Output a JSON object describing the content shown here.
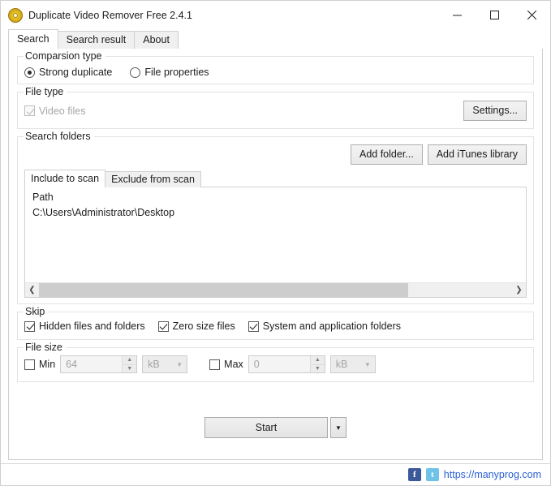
{
  "window": {
    "title": "Duplicate Video Remover Free 2.4.1",
    "icon": "app-disc-icon",
    "controls": {
      "minimize": "minimize-icon",
      "maximize": "maximize-icon",
      "close": "close-icon"
    }
  },
  "tabs": [
    {
      "label": "Search",
      "active": true
    },
    {
      "label": "Search result",
      "active": false
    },
    {
      "label": "About",
      "active": false
    }
  ],
  "comparison": {
    "group_label": "Comparsion type",
    "options": [
      {
        "label": "Strong duplicate",
        "checked": true
      },
      {
        "label": "File properties",
        "checked": false
      }
    ]
  },
  "file_type": {
    "group_label": "File type",
    "checkbox": {
      "label": "Video files",
      "checked": true,
      "disabled": true
    },
    "settings_button": "Settings..."
  },
  "search_folders": {
    "group_label": "Search folders",
    "add_folder_button": "Add folder...",
    "add_itunes_button": "Add iTunes library",
    "tabs": [
      {
        "label": "Include to scan",
        "active": true
      },
      {
        "label": "Exclude from scan",
        "active": false
      }
    ],
    "column_header": "Path",
    "rows": [
      "C:\\Users\\Administrator\\Desktop"
    ],
    "scroll": {
      "left_arrow": "chevron-left-icon",
      "right_arrow": "chevron-right-icon",
      "thumb_percent": 78
    }
  },
  "skip": {
    "group_label": "Skip",
    "options": [
      {
        "label": "Hidden files and folders",
        "checked": true
      },
      {
        "label": "Zero size files",
        "checked": true
      },
      {
        "label": "System and application folders",
        "checked": true
      }
    ]
  },
  "file_size": {
    "group_label": "File size",
    "min": {
      "label": "Min",
      "checked": false,
      "value": "64",
      "unit": "kB"
    },
    "max": {
      "label": "Max",
      "checked": false,
      "value": "0",
      "unit": "kB"
    }
  },
  "actions": {
    "start_label": "Start",
    "start_dropdown": "chevron-down-icon"
  },
  "statusbar": {
    "facebook_icon": "facebook-icon",
    "facebook_glyph": "f",
    "twitter_icon": "twitter-icon",
    "twitter_glyph": "t",
    "link": "https://manyprog.com"
  },
  "colors": {
    "link": "#2a5fd4",
    "facebook": "#3b5998",
    "twitter": "#6fc3e8",
    "accent_icon": "#e0b91f"
  }
}
